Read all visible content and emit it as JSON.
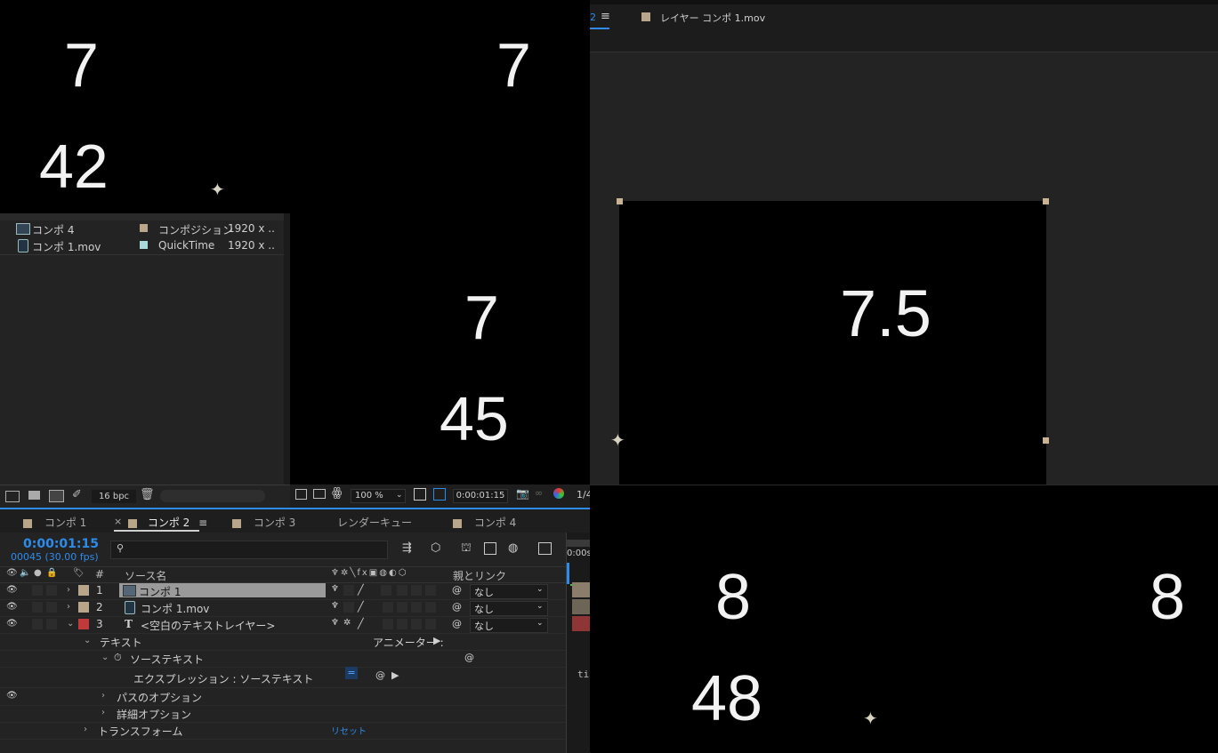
{
  "top_left_viewer": {
    "numbers": [
      "7",
      "7",
      "42"
    ]
  },
  "layer_panel": {
    "tab_fragment": "2",
    "menu_icon": "hamburger-menu-icon",
    "tab_label": "レイヤー コンポ 1.mov",
    "tab_color": "#b8a58a",
    "numbers": [
      "7.5"
    ]
  },
  "project_panel": {
    "items": [
      {
        "name": "コンポ 4",
        "type": "コンポジション",
        "size": "1920 x ..",
        "icon": "composition-icon",
        "color": "#b8a58a"
      },
      {
        "name": "コンポ 1.mov",
        "type": "QuickTime",
        "size": "1920 x ..",
        "icon": "quicktime-file-icon",
        "color": "#a8d8d8"
      }
    ],
    "footer": {
      "bpc": "16 bpc"
    }
  },
  "mid_viewer": {
    "numbers": [
      "7",
      "45"
    ],
    "toolbar": {
      "zoom": "100 %",
      "timecode": "0:00:01:15",
      "resolution": "1/4"
    }
  },
  "timeline": {
    "tabs": [
      {
        "label": "コンポ 1",
        "color": "#b8a58a",
        "active": false
      },
      {
        "label": "コンポ 2",
        "color": "#b8a58a",
        "active": true
      },
      {
        "label": "コンポ 3",
        "color": "#b8a58a",
        "active": false
      },
      {
        "label": "レンダーキュー",
        "color": "",
        "active": false
      },
      {
        "label": "コンポ 4",
        "color": "#b8a58a",
        "active": false
      }
    ],
    "close_mark": "×",
    "timecode": "0:00:01:15",
    "frame_info": "00045 (30.00 fps)",
    "columns": {
      "num": "#",
      "source": "ソース名",
      "parent": "親とリンク"
    },
    "layers": [
      {
        "index": "1",
        "name": "コンポ 1",
        "color": "#b8a58a",
        "parent": "なし",
        "icon": "composition-icon",
        "selected": true
      },
      {
        "index": "2",
        "name": "コンポ 1.mov",
        "color": "#b8a58a",
        "parent": "なし",
        "icon": "quicktime-file-icon",
        "selected": false
      },
      {
        "index": "3",
        "name": "<空白のテキストレイヤー>",
        "color": "#c0393b",
        "parent": "なし",
        "icon": "text-layer-icon",
        "selected": false
      }
    ],
    "properties": {
      "text": "テキスト",
      "animator": "アニメーター :",
      "source_text": "ソーステキスト",
      "expression": "エクスプレッション : ソーステキスト",
      "path_options": "パスのオプション",
      "more_options": "詳細オプション",
      "transform": "トランスフォーム",
      "reset": "リセット"
    },
    "graph_fragment": "ti",
    "ruler_fragment": "0:00s",
    "accent": "#2d8ceb"
  },
  "bottom_right_viewer": {
    "numbers": [
      "8",
      "8",
      "48"
    ]
  }
}
